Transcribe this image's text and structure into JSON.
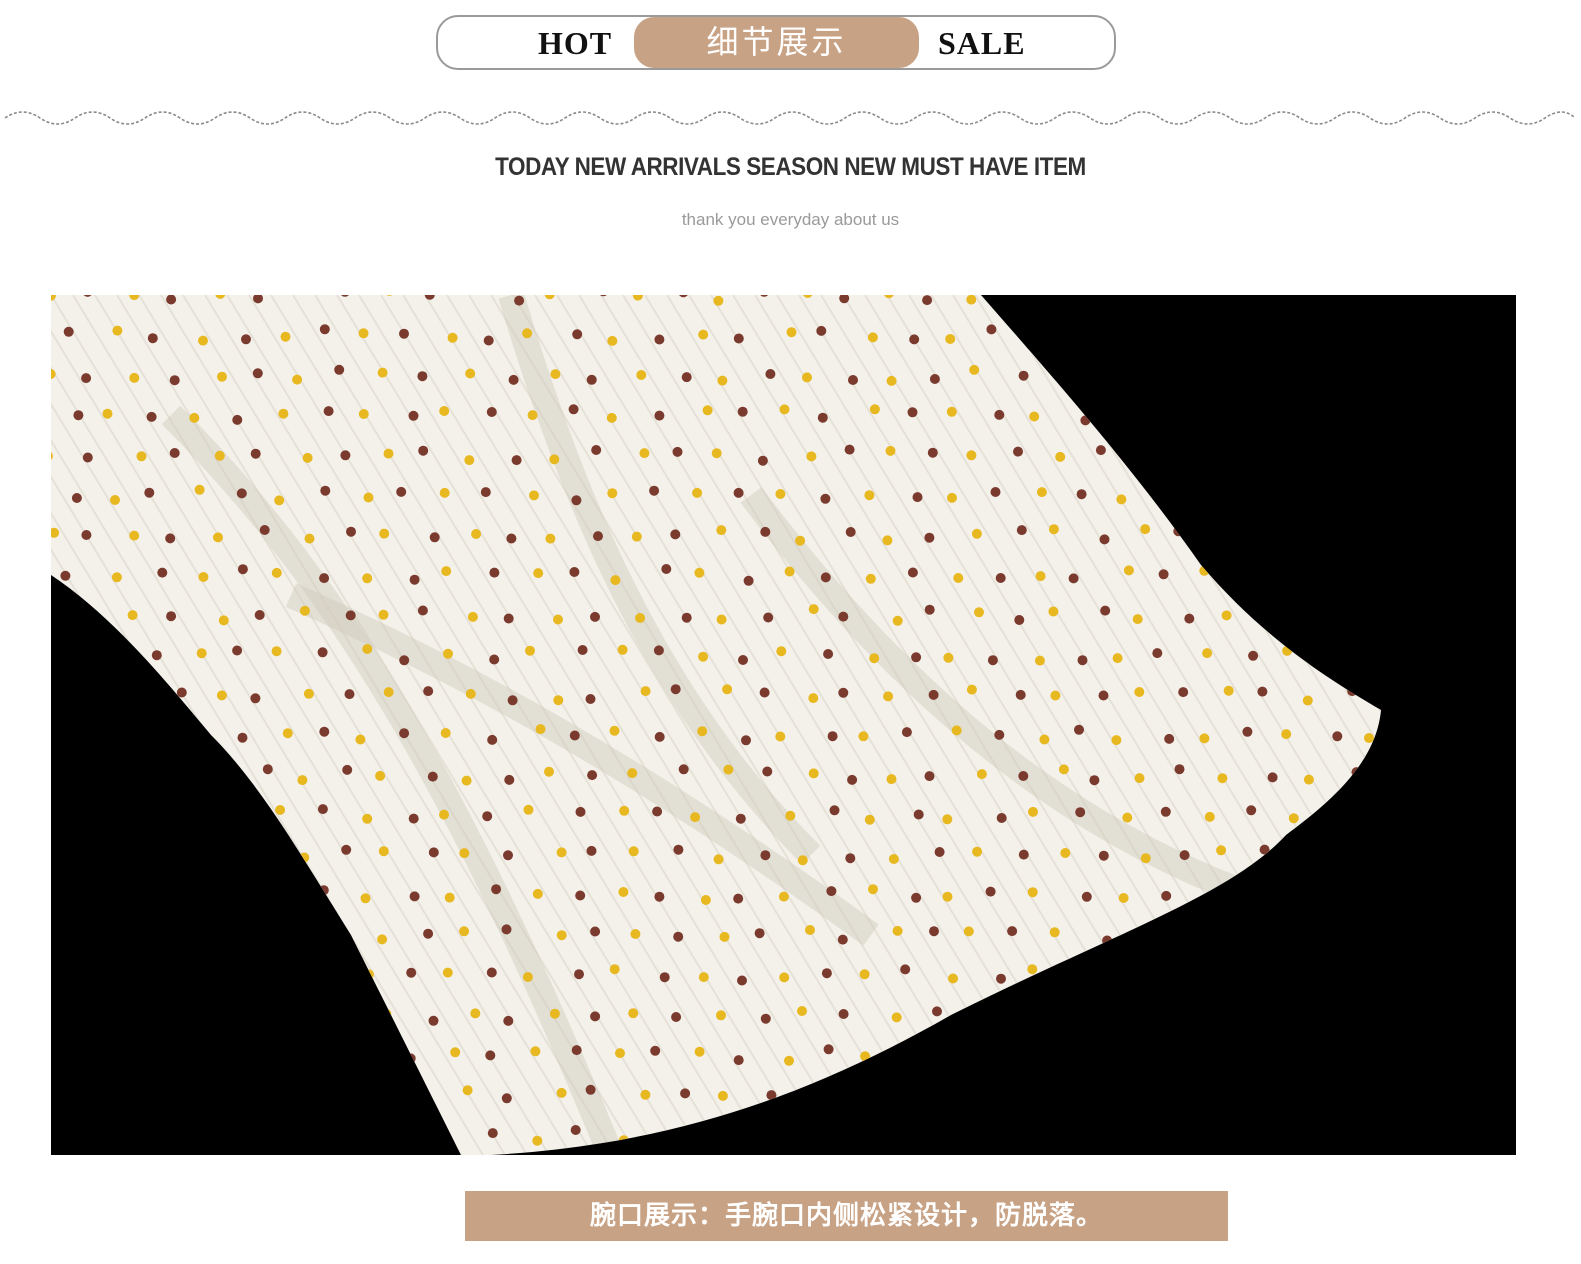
{
  "header": {
    "left_label": "HOT",
    "center_label": "细节展示",
    "right_label": "SALE"
  },
  "title": "TODAY NEW ARRIVALS  SEASON NEW MUST HAVE ITEM",
  "subtitle": "thank you everyday about us",
  "caption": "腕口展示：手腕口内侧松紧设计，防脱落。",
  "colors": {
    "accent": "#c8a285",
    "photo_background": "#000000",
    "knit": "#f3f1ea",
    "dot_yellow": "#e8b820",
    "dot_brown": "#7a3b2e"
  }
}
